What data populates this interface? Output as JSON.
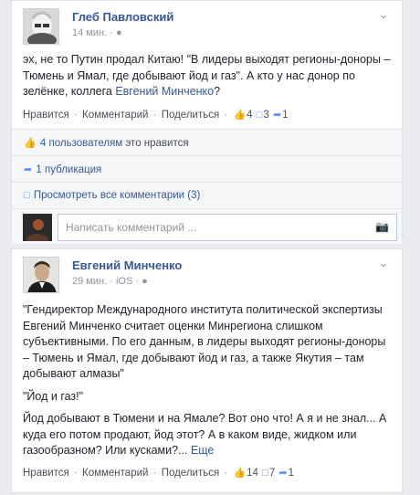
{
  "post1": {
    "author": "Глеб Павловский",
    "time": "14 мин.",
    "text_before_link": "эх, не то Путин продал Китаю! \"В лидеры выходят регионы-доноры – Тюмень и Ямал, где добывают йод и газ\". А кто у нас донор по зелёнке, коллега ",
    "mention": "Евгений Минченко",
    "text_after_link": "?",
    "actions": {
      "like": "Нравится",
      "comment": "Комментарий",
      "share": "Поделиться"
    },
    "counts": {
      "likes": "4",
      "comments": "3",
      "shares": "1"
    },
    "likes_summary": {
      "count_label": "4 пользователям",
      "suffix": "это нравится"
    },
    "shares_summary": "1 публикация",
    "view_comments": "Просмотреть все комментарии (3)",
    "comment_placeholder": "Написать комментарий ..."
  },
  "post2": {
    "author": "Евгений Минченко",
    "time": "29 мин.",
    "platform": "iOS",
    "paragraphs": [
      "\"Гендиректор Международного института политической экспертизы Евгений Минченко считает оценки Минрегиона слишком субъективными. По его данным, в лидеры выходят регионы-доноры – Тюмень и Ямал, где добывают йод и газ, а также Якутия – там добывают алмазы\"",
      "\"Йод и газ!\""
    ],
    "last_paragraph": "Йод добывают в Тюмени и на Ямале? Вот оно что! А я и не знал... А куда его потом продают, йод этот? А в каком виде, жидком или газообразном? Или кусками?...",
    "more": "Еще",
    "actions": {
      "like": "Нравится",
      "comment": "Комментарий",
      "share": "Поделиться"
    },
    "counts": {
      "likes": "14",
      "comments": "7",
      "shares": "1"
    }
  },
  "colors": {
    "link": "#365899",
    "icon": "#5890ff"
  }
}
